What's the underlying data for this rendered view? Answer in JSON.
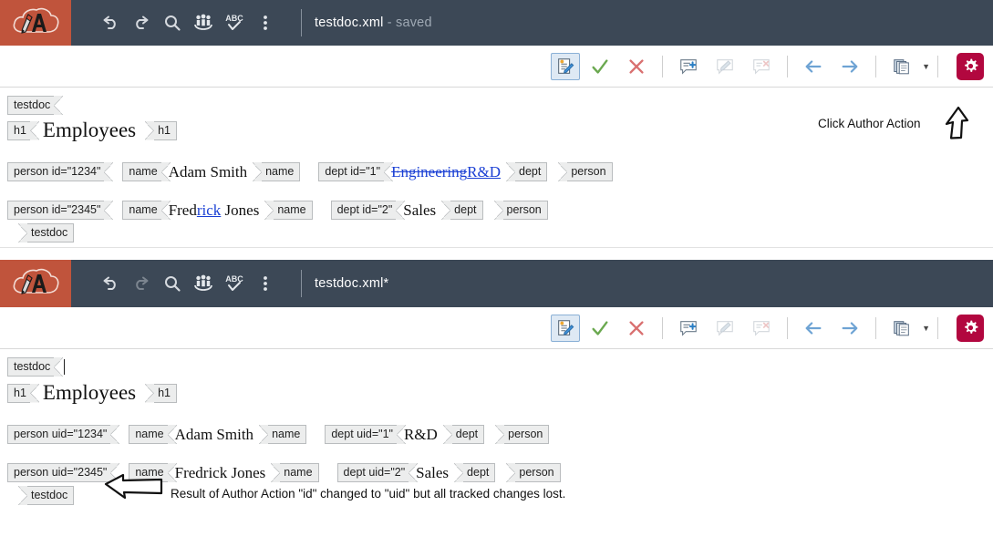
{
  "app": {
    "logo_name": "oxygen-author-cloud-logo",
    "brand_color": "#c0543c",
    "titlebar_color": "#3c4856",
    "gear_color": "#b2073f",
    "tracked_change_color": "#1a3fd4"
  },
  "panels": [
    {
      "id": "panel-1",
      "titlebar": {
        "document_name": "testdoc.xml",
        "document_state": " - saved",
        "icons": [
          {
            "name": "undo-icon",
            "label": "Undo",
            "enabled": true
          },
          {
            "name": "redo-icon",
            "label": "Redo",
            "enabled": true
          },
          {
            "name": "search-icon",
            "label": "Find/Replace",
            "enabled": true
          },
          {
            "name": "people-icon",
            "label": "Collaboration",
            "enabled": true
          },
          {
            "name": "spellcheck-abc-icon",
            "label": "ABC",
            "enabled": true
          },
          {
            "name": "more-options-icon",
            "label": "More",
            "enabled": true
          }
        ]
      },
      "actionbar": {
        "items": [
          {
            "name": "author-action-icon",
            "label": "Author Action",
            "selected": true,
            "enabled": true
          },
          {
            "name": "accept-change-icon",
            "label": "Accept Change",
            "selected": false,
            "enabled": true
          },
          {
            "name": "reject-change-icon",
            "label": "Reject Change",
            "selected": false,
            "enabled": true
          },
          {
            "name": "add-comment-icon",
            "label": "Add Comment",
            "selected": false,
            "enabled": true
          },
          {
            "name": "edit-comment-icon",
            "label": "Edit Comment",
            "selected": false,
            "enabled": false
          },
          {
            "name": "remove-comment-icon",
            "label": "Remove Comment",
            "selected": false,
            "enabled": false
          },
          {
            "name": "previous-change-icon",
            "label": "Previous Change",
            "selected": false,
            "enabled": true
          },
          {
            "name": "next-change-icon",
            "label": "Next Change",
            "selected": false,
            "enabled": true
          },
          {
            "name": "copy-documents-icon",
            "label": "Manage Changes",
            "selected": false,
            "enabled": true
          },
          {
            "name": "settings-gear-icon",
            "label": "Settings",
            "selected": false,
            "enabled": true
          }
        ]
      },
      "document": {
        "root_open": "testdoc",
        "root_close": "testdoc",
        "heading": {
          "tag_open": "h1",
          "text": "Employees",
          "tag_close": "h1"
        },
        "records": [
          {
            "person_open": "person id=\"1234\"",
            "name_open": "name",
            "name_text": "Adam Smith",
            "name_close": "name",
            "dept_open": "dept id=\"1\"",
            "dept_deleted": "Engineering",
            "dept_inserted": "R&D",
            "dept_plain": "",
            "dept_close": "dept",
            "person_close": "person"
          },
          {
            "person_open": "person id=\"2345\"",
            "name_open": "name",
            "name_plain_prefix": "Fred",
            "name_inserted": "rick",
            "name_plain_suffix": " Jones",
            "name_close": "name",
            "dept_open": "dept id=\"2\"",
            "dept_plain": "Sales",
            "dept_close": "dept",
            "person_close": "person"
          }
        ]
      }
    },
    {
      "id": "panel-2",
      "titlebar": {
        "document_name": "testdoc.xml*",
        "document_state": "",
        "icons": [
          {
            "name": "undo-icon",
            "label": "Undo",
            "enabled": true
          },
          {
            "name": "redo-icon",
            "label": "Redo",
            "enabled": false
          },
          {
            "name": "search-icon",
            "label": "Find/Replace",
            "enabled": true
          },
          {
            "name": "people-icon",
            "label": "Collaboration",
            "enabled": true
          },
          {
            "name": "spellcheck-abc-icon",
            "label": "ABC",
            "enabled": true
          },
          {
            "name": "more-options-icon",
            "label": "More",
            "enabled": true
          }
        ]
      },
      "actionbar": {
        "items": [
          {
            "name": "author-action-icon",
            "label": "Author Action",
            "selected": true,
            "enabled": true
          },
          {
            "name": "accept-change-icon",
            "label": "Accept Change",
            "selected": false,
            "enabled": true
          },
          {
            "name": "reject-change-icon",
            "label": "Reject Change",
            "selected": false,
            "enabled": true
          },
          {
            "name": "add-comment-icon",
            "label": "Add Comment",
            "selected": false,
            "enabled": true
          },
          {
            "name": "edit-comment-icon",
            "label": "Edit Comment",
            "selected": false,
            "enabled": false
          },
          {
            "name": "remove-comment-icon",
            "label": "Remove Comment",
            "selected": false,
            "enabled": false
          },
          {
            "name": "previous-change-icon",
            "label": "Previous Change",
            "selected": false,
            "enabled": true
          },
          {
            "name": "next-change-icon",
            "label": "Next Change",
            "selected": false,
            "enabled": true
          },
          {
            "name": "copy-documents-icon",
            "label": "Manage Changes",
            "selected": false,
            "enabled": true
          },
          {
            "name": "settings-gear-icon",
            "label": "Settings",
            "selected": false,
            "enabled": true
          }
        ]
      },
      "document": {
        "root_open": "testdoc",
        "root_close": "testdoc",
        "heading": {
          "tag_open": "h1",
          "text": "Employees",
          "tag_close": "h1"
        },
        "records": [
          {
            "person_open": "person uid=\"1234\"",
            "name_open": "name",
            "name_text": "Adam Smith",
            "name_close": "name",
            "dept_open": "dept uid=\"1\"",
            "dept_plain": "R&D",
            "dept_close": "dept",
            "person_close": "person"
          },
          {
            "person_open": "person uid=\"2345\"",
            "name_open": "name",
            "name_text": "Fredrick Jones",
            "name_close": "name",
            "dept_open": "dept uid=\"2\"",
            "dept_plain": "Sales",
            "dept_close": "dept",
            "person_close": "person"
          }
        ]
      }
    }
  ],
  "annotations": {
    "top": "Click Author Action",
    "bottom": "Result of Author Action \"id\" changed to \"uid\" but all tracked changes lost.",
    "top_arrow_name": "arrow-up-pointer",
    "bottom_arrow_name": "arrow-left-pointer"
  }
}
